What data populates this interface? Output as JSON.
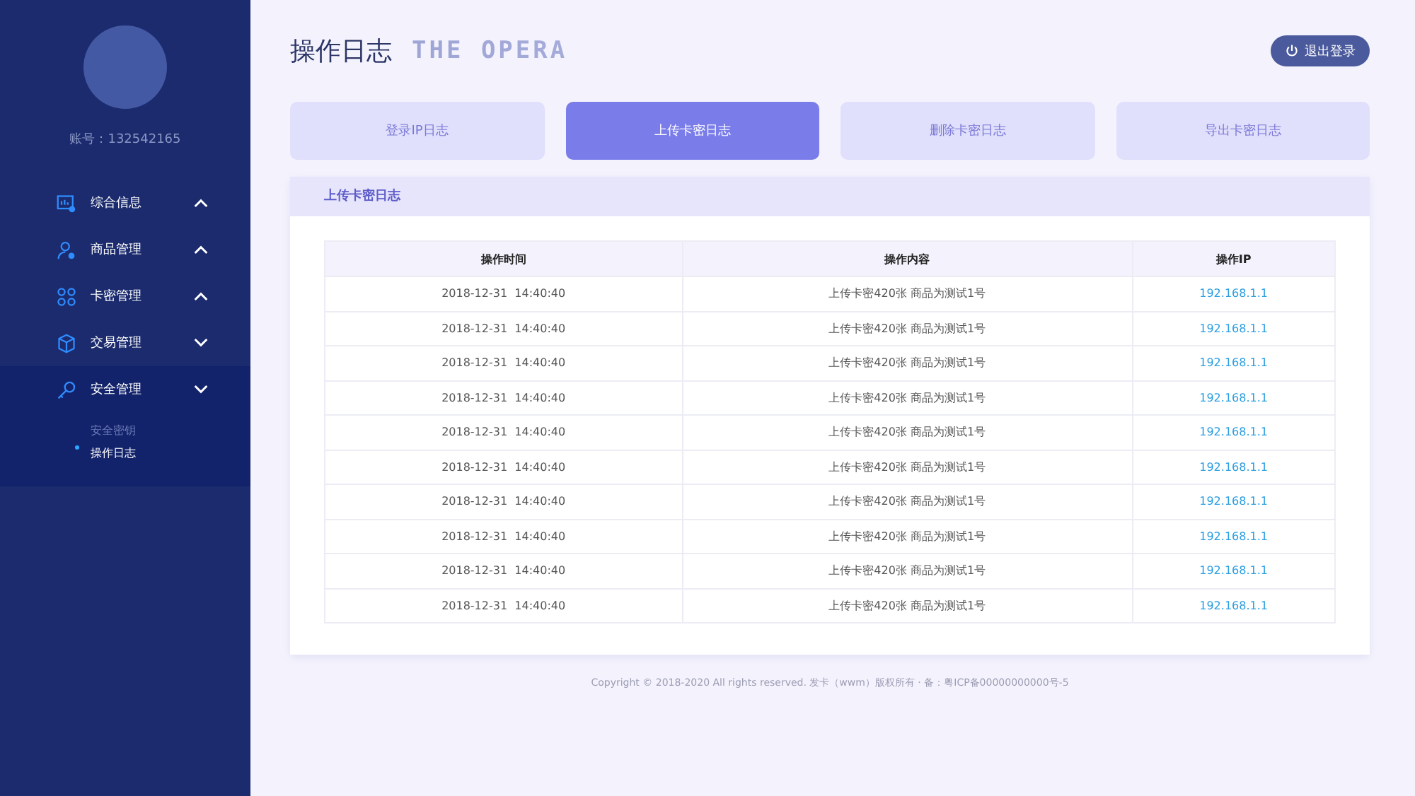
{
  "sidebar": {
    "account": "账号：132542165",
    "items": [
      {
        "label": "综合信息",
        "expanded": true,
        "selected": false
      },
      {
        "label": "商品管理",
        "expanded": true,
        "selected": false
      },
      {
        "label": "卡密管理",
        "expanded": true,
        "selected": false
      },
      {
        "label": "交易管理",
        "expanded": false,
        "selected": false
      },
      {
        "label": "安全管理",
        "expanded": false,
        "selected": true,
        "children": [
          {
            "label": "安全密钥",
            "selected": false
          },
          {
            "label": "操作日志",
            "selected": true
          }
        ]
      }
    ]
  },
  "header": {
    "title": "操作日志",
    "watermark_title": "THE OPERA",
    "logout": "退出登录"
  },
  "tabs": [
    {
      "label": "登录IP日志",
      "selected": false
    },
    {
      "label": "上传卡密日志",
      "selected": true
    },
    {
      "label": "删除卡密日志",
      "selected": false
    },
    {
      "label": "导出卡密日志",
      "selected": false
    }
  ],
  "panel": {
    "title": "上传卡密日志"
  },
  "table": {
    "columns": [
      "操作时间",
      "操作内容",
      "操作IP"
    ],
    "rows": [
      [
        "2018-12-31  14:40:40",
        "上传卡密420张 商品为测试1号",
        "192.168.1.1"
      ],
      [
        "2018-12-31  14:40:40",
        "上传卡密420张 商品为测试1号",
        "192.168.1.1"
      ],
      [
        "2018-12-31  14:40:40",
        "上传卡密420张 商品为测试1号",
        "192.168.1.1"
      ],
      [
        "2018-12-31  14:40:40",
        "上传卡密420张 商品为测试1号",
        "192.168.1.1"
      ],
      [
        "2018-12-31  14:40:40",
        "上传卡密420张 商品为测试1号",
        "192.168.1.1"
      ],
      [
        "2018-12-31  14:40:40",
        "上传卡密420张 商品为测试1号",
        "192.168.1.1"
      ],
      [
        "2018-12-31  14:40:40",
        "上传卡密420张 商品为测试1号",
        "192.168.1.1"
      ],
      [
        "2018-12-31  14:40:40",
        "上传卡密420张 商品为测试1号",
        "192.168.1.1"
      ],
      [
        "2018-12-31  14:40:40",
        "上传卡密420张 商品为测试1号",
        "192.168.1.1"
      ],
      [
        "2018-12-31  14:40:40",
        "上传卡密420张 商品为测试1号",
        "192.168.1.1"
      ]
    ]
  },
  "footer": "Copyright © 2018-2020 All rights reserved. 发卡（wwm）版权所有 · 备：粤ICP备00000000000号-5"
}
